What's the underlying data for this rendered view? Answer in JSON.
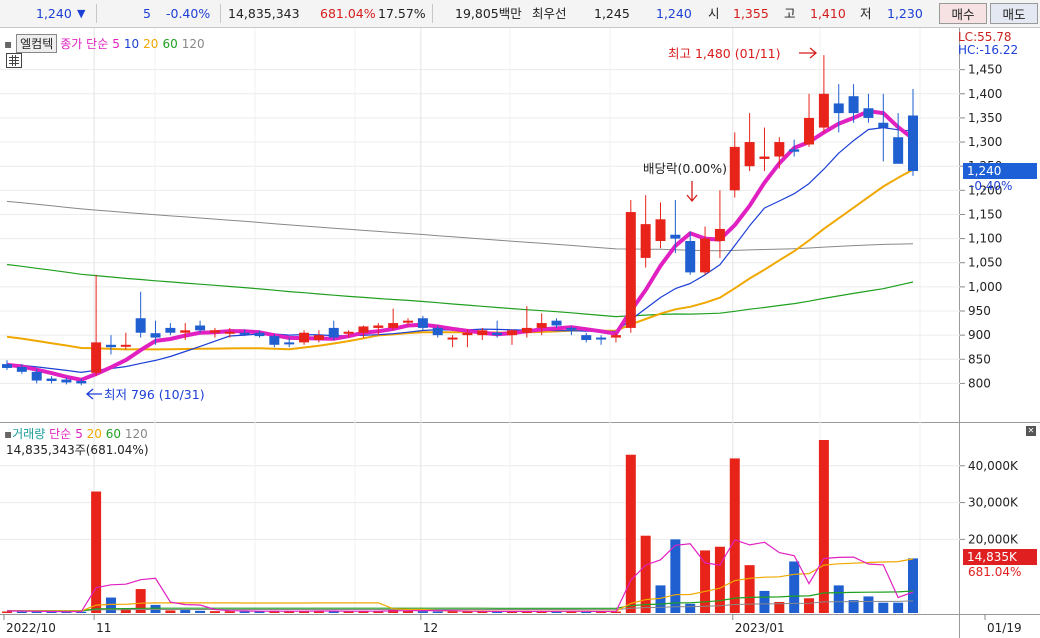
{
  "topbar": {
    "price": "1,240",
    "direction_icon": "down-triangle-icon",
    "change": "5",
    "change_pct": "-0.40%",
    "volume": "14,835,343",
    "volume_ratio": "681.04%",
    "turnover": "17.57%",
    "amount": "19,805백만",
    "best_label": "최우선",
    "best_ask": "1,245",
    "best_bid": "1,240",
    "open_label": "시",
    "open": "1,355",
    "high_label": "고",
    "high": "1,410",
    "low_label": "저",
    "low": "1,230",
    "buy_label": "매수",
    "sell_label": "매도"
  },
  "legend": {
    "name_box": "엘컴텍",
    "price_label": "종가 단순",
    "ma5": "5",
    "ma10": "10",
    "ma20": "20",
    "ma60": "60",
    "ma120": "120"
  },
  "volume_legend": {
    "label": "거래량",
    "simple_label": "단순",
    "ma5": "5",
    "ma20": "20",
    "ma60": "60",
    "ma120": "120",
    "info": "14,835,343주(681.04%)"
  },
  "right_panel": {
    "lc": "LC:55.78",
    "hc": "HC:-16.22",
    "current_price": "1,240",
    "current_change": "-0.40%",
    "current_volume": "14,835K",
    "current_volume_pct": "681.04%"
  },
  "annotations": {
    "high_note": "최고 1,480 (01/11)",
    "low_note": "최저 796 (10/31)",
    "dividend_note": "배당락(0.00%)"
  },
  "colors": {
    "up": "#e8231a",
    "down": "#1f5fd0",
    "ma5": "#e020c0",
    "ma10": "#1c3fd6",
    "ma20": "#f0a800",
    "ma60": "#20a020",
    "ma120": "#888888"
  },
  "chart_data": [
    {
      "type": "candlestick",
      "title": "엘컴텍",
      "y_ticks": [
        "1,450",
        "1,400",
        "1,350",
        "1,300",
        "1,250",
        "1,200",
        "1,150",
        "1,100",
        "1,050",
        "1,000",
        "950",
        "900",
        "850",
        "800"
      ],
      "ylim": [
        776,
        1470
      ],
      "x_ticks": [
        "2022/10",
        "11",
        "12",
        "2023/01",
        "01/19"
      ],
      "candles": [
        {
          "o": 840,
          "h": 848,
          "l": 828,
          "c": 832
        },
        {
          "o": 834,
          "h": 840,
          "l": 820,
          "c": 824
        },
        {
          "o": 824,
          "h": 830,
          "l": 800,
          "c": 806
        },
        {
          "o": 810,
          "h": 815,
          "l": 800,
          "c": 805
        },
        {
          "o": 808,
          "h": 812,
          "l": 798,
          "c": 802
        },
        {
          "o": 805,
          "h": 810,
          "l": 796,
          "c": 800
        },
        {
          "o": 822,
          "h": 1025,
          "l": 815,
          "c": 885
        },
        {
          "o": 880,
          "h": 900,
          "l": 860,
          "c": 875
        },
        {
          "o": 878,
          "h": 905,
          "l": 870,
          "c": 880
        },
        {
          "o": 935,
          "h": 990,
          "l": 895,
          "c": 905
        },
        {
          "o": 904,
          "h": 930,
          "l": 880,
          "c": 895
        },
        {
          "o": 915,
          "h": 925,
          "l": 900,
          "c": 905
        },
        {
          "o": 905,
          "h": 925,
          "l": 890,
          "c": 910
        },
        {
          "o": 920,
          "h": 930,
          "l": 905,
          "c": 910
        },
        {
          "o": 905,
          "h": 915,
          "l": 895,
          "c": 910
        },
        {
          "o": 905,
          "h": 915,
          "l": 895,
          "c": 907
        },
        {
          "o": 905,
          "h": 912,
          "l": 898,
          "c": 904
        },
        {
          "o": 905,
          "h": 910,
          "l": 895,
          "c": 898
        },
        {
          "o": 898,
          "h": 902,
          "l": 875,
          "c": 880
        },
        {
          "o": 885,
          "h": 895,
          "l": 875,
          "c": 882
        },
        {
          "o": 885,
          "h": 910,
          "l": 880,
          "c": 905
        },
        {
          "o": 890,
          "h": 910,
          "l": 885,
          "c": 900
        },
        {
          "o": 915,
          "h": 930,
          "l": 890,
          "c": 895
        },
        {
          "o": 905,
          "h": 910,
          "l": 895,
          "c": 907
        },
        {
          "o": 905,
          "h": 920,
          "l": 895,
          "c": 918
        },
        {
          "o": 915,
          "h": 925,
          "l": 900,
          "c": 920
        },
        {
          "o": 915,
          "h": 955,
          "l": 910,
          "c": 925
        },
        {
          "o": 930,
          "h": 935,
          "l": 920,
          "c": 930
        },
        {
          "o": 935,
          "h": 940,
          "l": 910,
          "c": 915
        },
        {
          "o": 915,
          "h": 920,
          "l": 895,
          "c": 900
        },
        {
          "o": 895,
          "h": 900,
          "l": 875,
          "c": 895
        },
        {
          "o": 900,
          "h": 912,
          "l": 875,
          "c": 905
        },
        {
          "o": 900,
          "h": 915,
          "l": 890,
          "c": 910
        },
        {
          "o": 905,
          "h": 930,
          "l": 895,
          "c": 900
        },
        {
          "o": 900,
          "h": 912,
          "l": 880,
          "c": 910
        },
        {
          "o": 905,
          "h": 960,
          "l": 895,
          "c": 915
        },
        {
          "o": 915,
          "h": 945,
          "l": 900,
          "c": 925
        },
        {
          "o": 930,
          "h": 935,
          "l": 915,
          "c": 920
        },
        {
          "o": 915,
          "h": 918,
          "l": 900,
          "c": 912
        },
        {
          "o": 900,
          "h": 905,
          "l": 885,
          "c": 890
        },
        {
          "o": 895,
          "h": 900,
          "l": 880,
          "c": 893
        },
        {
          "o": 895,
          "h": 905,
          "l": 885,
          "c": 900
        },
        {
          "o": 915,
          "h": 1180,
          "l": 905,
          "c": 1155
        },
        {
          "o": 1060,
          "h": 1190,
          "l": 1040,
          "c": 1130
        },
        {
          "o": 1095,
          "h": 1175,
          "l": 1080,
          "c": 1140
        },
        {
          "o": 1108,
          "h": 1180,
          "l": 1070,
          "c": 1100
        },
        {
          "o": 1095,
          "h": 1115,
          "l": 1025,
          "c": 1030
        },
        {
          "o": 1030,
          "h": 1125,
          "l": 1025,
          "c": 1100
        },
        {
          "o": 1095,
          "h": 1200,
          "l": 1060,
          "c": 1120
        },
        {
          "o": 1200,
          "h": 1320,
          "l": 1185,
          "c": 1290
        },
        {
          "o": 1250,
          "h": 1360,
          "l": 1240,
          "c": 1300
        },
        {
          "o": 1265,
          "h": 1330,
          "l": 1240,
          "c": 1270
        },
        {
          "o": 1270,
          "h": 1310,
          "l": 1245,
          "c": 1300
        },
        {
          "o": 1285,
          "h": 1305,
          "l": 1270,
          "c": 1280
        },
        {
          "o": 1295,
          "h": 1400,
          "l": 1290,
          "c": 1350
        },
        {
          "o": 1330,
          "h": 1480,
          "l": 1320,
          "c": 1400
        },
        {
          "o": 1380,
          "h": 1420,
          "l": 1320,
          "c": 1360
        },
        {
          "o": 1395,
          "h": 1420,
          "l": 1340,
          "c": 1360
        },
        {
          "o": 1370,
          "h": 1400,
          "l": 1340,
          "c": 1350
        },
        {
          "o": 1340,
          "h": 1400,
          "l": 1260,
          "c": 1330
        },
        {
          "o": 1310,
          "h": 1360,
          "l": 1260,
          "c": 1255
        },
        {
          "o": 1355,
          "h": 1410,
          "l": 1230,
          "c": 1240
        }
      ]
    },
    {
      "type": "bar",
      "title": "거래량",
      "y_ticks": [
        "40,000K",
        "30,000K",
        "20,000K"
      ],
      "ylim": [
        0,
        47000
      ],
      "values_k": [
        400,
        350,
        350,
        300,
        400,
        350,
        33000,
        4200,
        1200,
        6500,
        2200,
        700,
        800,
        600,
        500,
        500,
        400,
        500,
        600,
        500,
        500,
        600,
        500,
        400,
        500,
        500,
        1100,
        600,
        500,
        400,
        500,
        400,
        500,
        400,
        400,
        500,
        400,
        600,
        500,
        300,
        300,
        400,
        43000,
        21000,
        7500,
        20000,
        2500,
        17000,
        18000,
        42000,
        13000,
        6000,
        3000,
        14000,
        4000,
        47000,
        7500,
        3500,
        4500,
        2800,
        2800,
        14835
      ],
      "up_flags": [
        1,
        0,
        0,
        0,
        0,
        0,
        1,
        0,
        1,
        1,
        0,
        1,
        0,
        0,
        1,
        1,
        0,
        0,
        1,
        1,
        1,
        1,
        0,
        1,
        1,
        1,
        1,
        1,
        0,
        0,
        1,
        1,
        1,
        0,
        1,
        1,
        1,
        0,
        1,
        0,
        1,
        1,
        1,
        1,
        0,
        0,
        0,
        1,
        1,
        1,
        1,
        0,
        1,
        0,
        1,
        1,
        0,
        0,
        0,
        0,
        0,
        0
      ]
    }
  ]
}
